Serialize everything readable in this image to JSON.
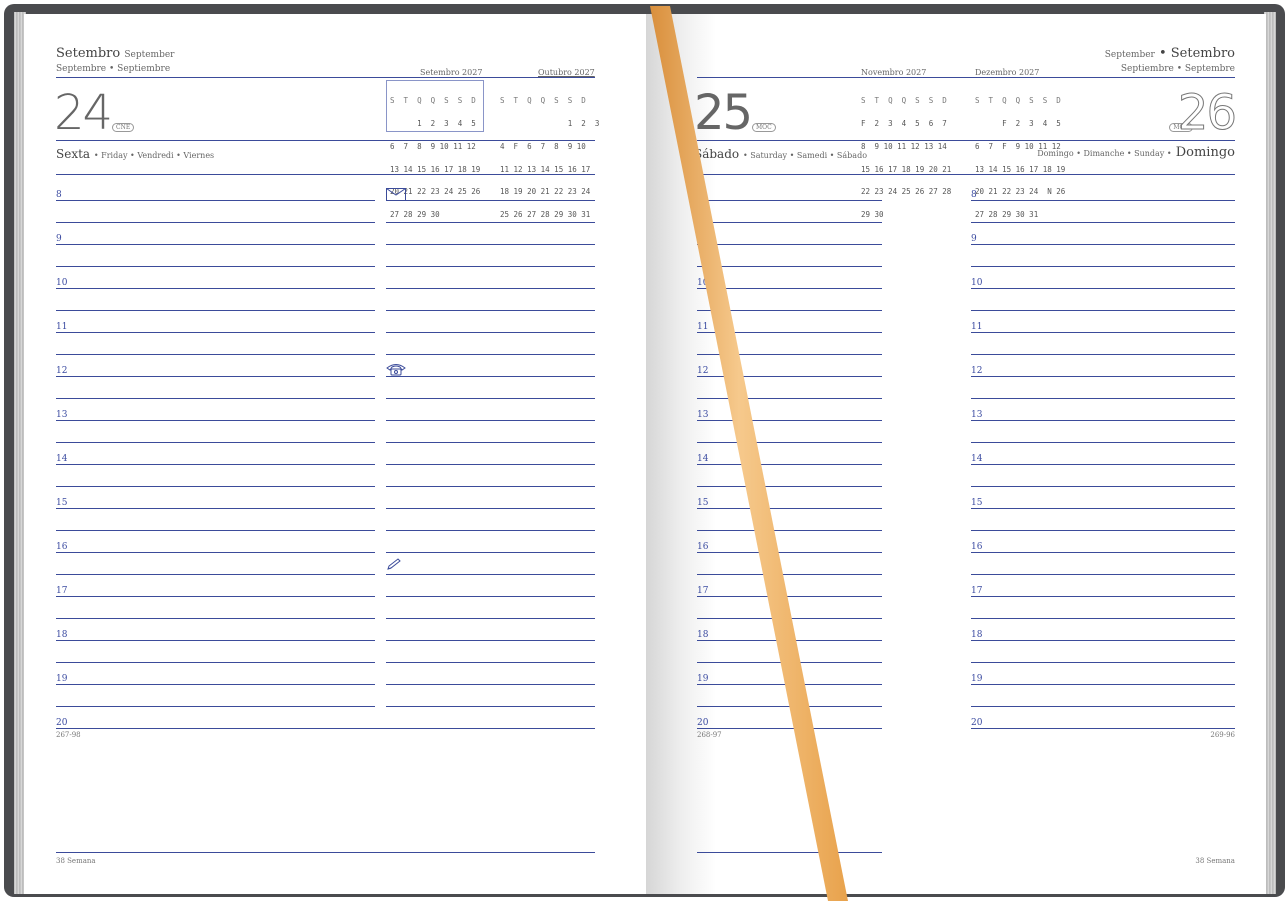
{
  "left": {
    "month_pt": "Setembro",
    "month_en": "September",
    "month_fr_es": "Septembre • Septiembre",
    "day_number": "24",
    "moon_badge": "CNE",
    "weekday_pt": "Sexta",
    "weekday_others": "• Friday • Vendredi • Viernes",
    "day_count": "267-98",
    "week": "38 Semana"
  },
  "right": {
    "month_en": "September",
    "month_pt": "Setembro",
    "month_es_fr": "Septiembre • Septembre",
    "saturday_number": "25",
    "saturday_badge": "MOC",
    "saturday_pt": "Sábado",
    "saturday_others": "• Saturday • Samedi • Sábado",
    "sunday_number": "26",
    "sunday_badge": "MOC",
    "sunday_others": "Domingo • Dimanche • Sunday •",
    "sunday_pt": "Domingo",
    "saturday_count": "268-97",
    "sunday_count": "269-96",
    "week": "38 Semana"
  },
  "hours": [
    "8",
    "9",
    "10",
    "11",
    "12",
    "13",
    "14",
    "15",
    "16",
    "17",
    "18",
    "19",
    "20"
  ],
  "mini_calendars": [
    {
      "title": "Setembro 2027",
      "header": "S  T  Q  Q  S  S  D",
      "rows": [
        "      1  2  3  4  5",
        "6  7  8  9 10 11 12",
        "13 14 15 16 17 18 19",
        "20 21 22 23 24 25 26",
        "27 28 29 30"
      ]
    },
    {
      "title": "Outubro 2027",
      "header": "S  T  Q  Q  S  S  D",
      "rows": [
        "               1  2  3",
        "4  F  6  7  8  9 10",
        "11 12 13 14 15 16 17",
        "18 19 20 21 22 23 24",
        "25 26 27 28 29 30 31"
      ]
    },
    {
      "title": "Novembro 2027",
      "header": "S  T  Q  Q  S  S  D",
      "rows": [
        "F  2  3  4  5  6  7",
        "8  9 10 11 12 13 14",
        "15 16 17 18 19 20 21",
        "22 23 24 25 26 27 28",
        "29 30"
      ]
    },
    {
      "title": "Dezembro 2027",
      "header": "S  T  Q  Q  S  S  D",
      "rows": [
        "      F  2  3  4  5",
        "6  7  F  9 10 11 12",
        "13 14 15 16 17 18 19",
        "20 21 22 23 24  N 26",
        "27 28 29 30 31"
      ]
    }
  ],
  "icons": {
    "mail": "envelope-icon",
    "phone": "telephone-icon",
    "note": "pencil-icon"
  },
  "colors": {
    "ink_blue": "#2e3f96",
    "cover": "#4a4b4e",
    "ribbon": "#f0b564"
  }
}
